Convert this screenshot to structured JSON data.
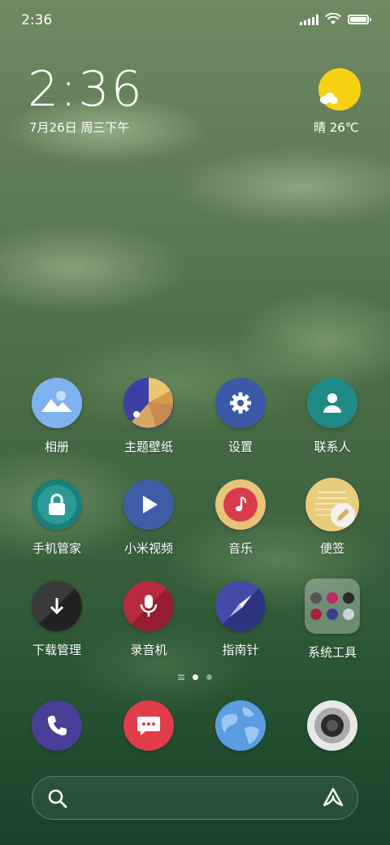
{
  "status_bar": {
    "time": "2:36"
  },
  "clock": {
    "time": "2:36",
    "date": "7月26日 周三下午"
  },
  "weather": {
    "text": "晴 26℃"
  },
  "apps": [
    {
      "label": "相册",
      "icon": "gallery-icon"
    },
    {
      "label": "主题壁纸",
      "icon": "themes-icon"
    },
    {
      "label": "设置",
      "icon": "gear-icon"
    },
    {
      "label": "联系人",
      "icon": "contacts-icon"
    },
    {
      "label": "手机管家",
      "icon": "lock-icon"
    },
    {
      "label": "小米视频",
      "icon": "play-icon"
    },
    {
      "label": "音乐",
      "icon": "music-note-icon"
    },
    {
      "label": "便签",
      "icon": "notes-pencil-icon"
    },
    {
      "label": "下载管理",
      "icon": "download-arrow-icon"
    },
    {
      "label": "录音机",
      "icon": "microphone-icon"
    },
    {
      "label": "指南针",
      "icon": "compass-icon"
    },
    {
      "label": "系统工具",
      "icon": "folder-icon"
    }
  ],
  "dock": [
    {
      "icon": "phone-icon"
    },
    {
      "icon": "messages-icon"
    },
    {
      "icon": "browser-globe-icon"
    },
    {
      "icon": "camera-icon"
    }
  ],
  "page_indicator": {
    "pages": 2,
    "active": 1
  },
  "colors": {
    "gallery": "#7fb3f0",
    "themes": "#3d3fa6",
    "settings": "#3a5aa8",
    "contacts": "#1f8a86",
    "security": "#1a7e7a",
    "video": "#3d5ea6",
    "music": "#e8c37a",
    "notes": "#e9cd7e",
    "downloads": "#2a2a2a",
    "recorder": "#a8233a",
    "compass": "#3a3f94",
    "phone": "#4a3f96",
    "messages": "#e03c4a",
    "browser": "#5a9de0",
    "camera": "#e8e8e8",
    "sun": "#f8d211"
  }
}
